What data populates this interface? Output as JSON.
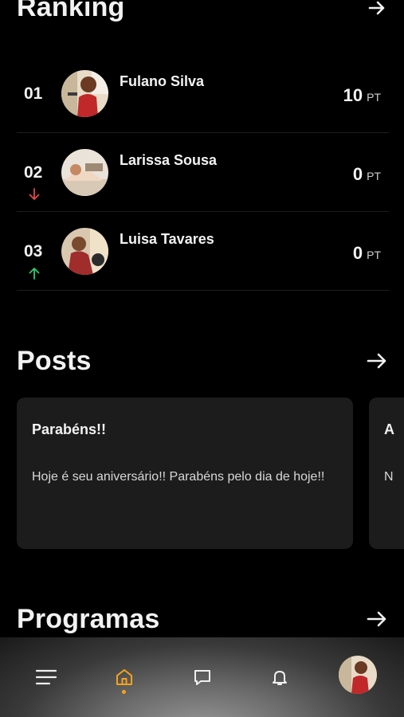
{
  "ranking": {
    "title": "Ranking",
    "rows": [
      {
        "position": "01",
        "name": "Fulano Silva",
        "score": "10",
        "unit": "PT",
        "trend": "none"
      },
      {
        "position": "02",
        "name": "Larissa Sousa",
        "score": "0",
        "unit": "PT",
        "trend": "down"
      },
      {
        "position": "03",
        "name": "Luisa Tavares",
        "score": "0",
        "unit": "PT",
        "trend": "up"
      }
    ]
  },
  "posts": {
    "title": "Posts",
    "cards": [
      {
        "title": "Parabéns!!",
        "body": "Hoje é seu aniversário!!  Parabéns pelo dia de hoje!!"
      },
      {
        "title": "A",
        "body": "N"
      }
    ]
  },
  "programas": {
    "title": "Programas"
  },
  "nav": {
    "items": [
      "menu-icon",
      "home-icon",
      "chat-icon",
      "bell-icon",
      "profile-avatar"
    ],
    "active": "home-icon",
    "accent": "#f7a21b"
  },
  "colors": {
    "trend_down": "#e5484d",
    "trend_up": "#2ecc71",
    "card_bg": "#1c1c1c"
  }
}
